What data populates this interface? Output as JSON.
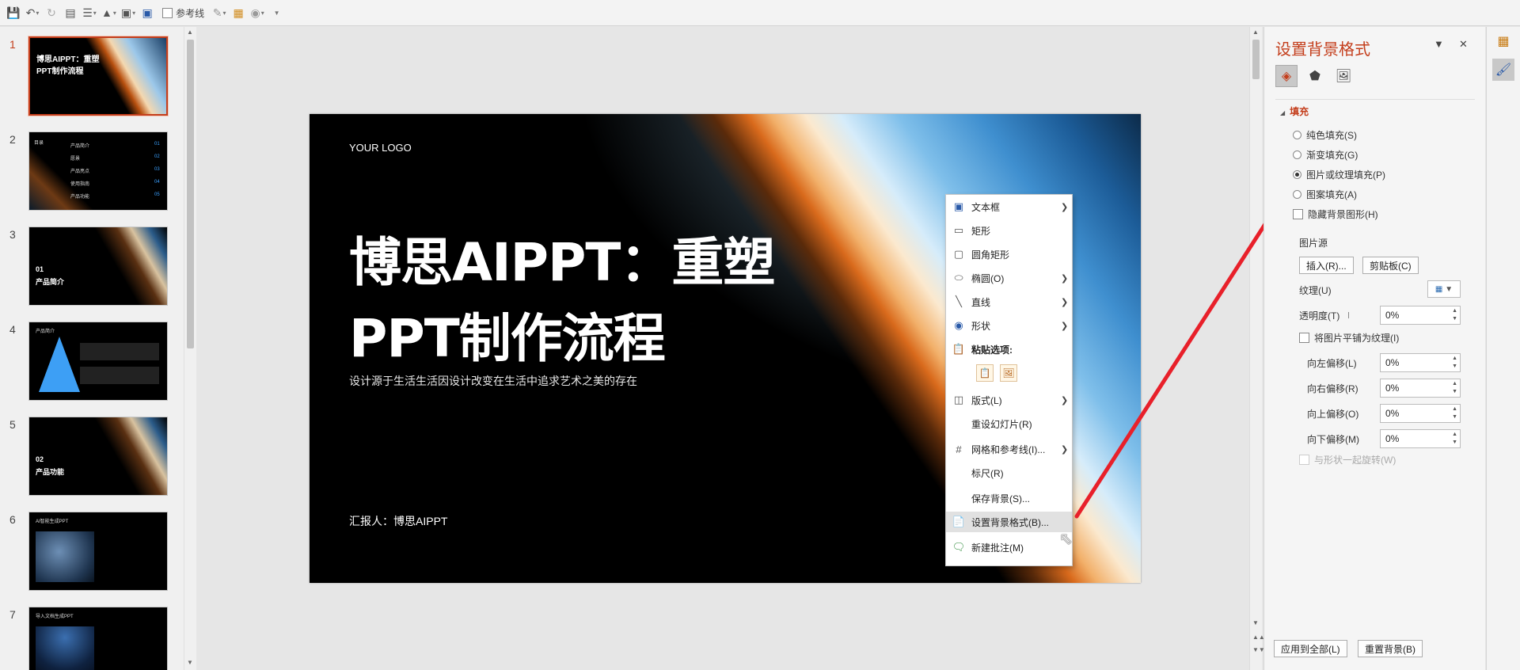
{
  "toolbar": {
    "icons": [
      "save-icon",
      "undo-icon",
      "redo-icon",
      "format-painter-icon",
      "align-icon",
      "fill-icon",
      "shape-icon",
      "textbox-icon"
    ],
    "guides_label": "参考线"
  },
  "thumbnails": [
    {
      "num": "1",
      "title": "博思AIPPT：重塑\nPPT制作流程",
      "selected": true
    },
    {
      "num": "2",
      "title": "",
      "toc_label": "目录",
      "rows": [
        [
          "产品简介",
          "01"
        ],
        [
          "愿景",
          "02"
        ],
        [
          "产品亮点",
          "03"
        ],
        [
          "使用指南",
          "04"
        ],
        [
          "产品功能",
          "05"
        ]
      ]
    },
    {
      "num": "3",
      "title": "01\n产品简介"
    },
    {
      "num": "4",
      "title": "产品简介"
    },
    {
      "num": "5",
      "title": "02\n产品功能"
    },
    {
      "num": "6",
      "title": "AI智能生成PPT"
    },
    {
      "num": "7",
      "title": "导入文档生成PPT"
    }
  ],
  "slide": {
    "logo": "YOUR LOGO",
    "title": "博思AIPPT：重塑\nPPT制作流程",
    "subtitle": "设计源于生活生活因设计改变在生活中追求艺术之美的存在",
    "reporter": "汇报人：博思AIPPT"
  },
  "context_menu": {
    "items": [
      {
        "label": "文本框",
        "icon": "textbox-icon",
        "submenu": true
      },
      {
        "label": "矩形",
        "icon": "rectangle-icon",
        "submenu": false
      },
      {
        "label": "圆角矩形",
        "icon": "rounded-rectangle-icon",
        "submenu": false
      },
      {
        "label": "椭圆(O)",
        "icon": "ellipse-icon",
        "submenu": true
      },
      {
        "label": "直线",
        "icon": "line-icon",
        "submenu": true
      },
      {
        "label": "形状",
        "icon": "shapes-icon",
        "submenu": true
      }
    ],
    "paste_header": "粘贴选项:",
    "items2": [
      {
        "label": "版式(L)",
        "icon": "layout-icon",
        "submenu": true
      },
      {
        "label": "重设幻灯片(R)",
        "icon": "",
        "submenu": false
      },
      {
        "label": "网格和参考线(I)...",
        "icon": "grid-icon",
        "submenu": true
      },
      {
        "label": "标尺(R)",
        "icon": "",
        "submenu": false
      },
      {
        "label": "保存背景(S)...",
        "icon": "",
        "submenu": false
      },
      {
        "label": "设置背景格式(B)...",
        "icon": "format-background-icon",
        "submenu": false,
        "highlighted": true
      },
      {
        "label": "新建批注(M)",
        "icon": "new-comment-icon",
        "submenu": false
      }
    ]
  },
  "panel": {
    "title": "设置背景格式",
    "section": "填充",
    "fill_options": [
      {
        "label": "纯色填充(S)",
        "checked": false
      },
      {
        "label": "渐变填充(G)",
        "checked": false
      },
      {
        "label": "图片或纹理填充(P)",
        "checked": true
      },
      {
        "label": "图案填充(A)",
        "checked": false
      }
    ],
    "hide_bg_graphics": "隐藏背景图形(H)",
    "picture_source": "图片源",
    "insert_btn": "插入(R)...",
    "clipboard_btn": "剪贴板(C)",
    "texture_label": "纹理(U)",
    "transparency_label": "透明度(T)",
    "transparency_value": "0%",
    "tile_label": "将图片平铺为纹理(I)",
    "offsets": [
      {
        "label": "向左偏移(L)",
        "value": "0%"
      },
      {
        "label": "向右偏移(R)",
        "value": "0%"
      },
      {
        "label": "向上偏移(O)",
        "value": "0%"
      },
      {
        "label": "向下偏移(M)",
        "value": "0%"
      }
    ],
    "rotate_label": "与形状一起旋转(W)",
    "apply_all_btn": "应用到全部(L)",
    "reset_btn": "重置背景(B)"
  },
  "colors": {
    "accent": "#c43e1c",
    "annotation_arrow": "#e8202a"
  }
}
